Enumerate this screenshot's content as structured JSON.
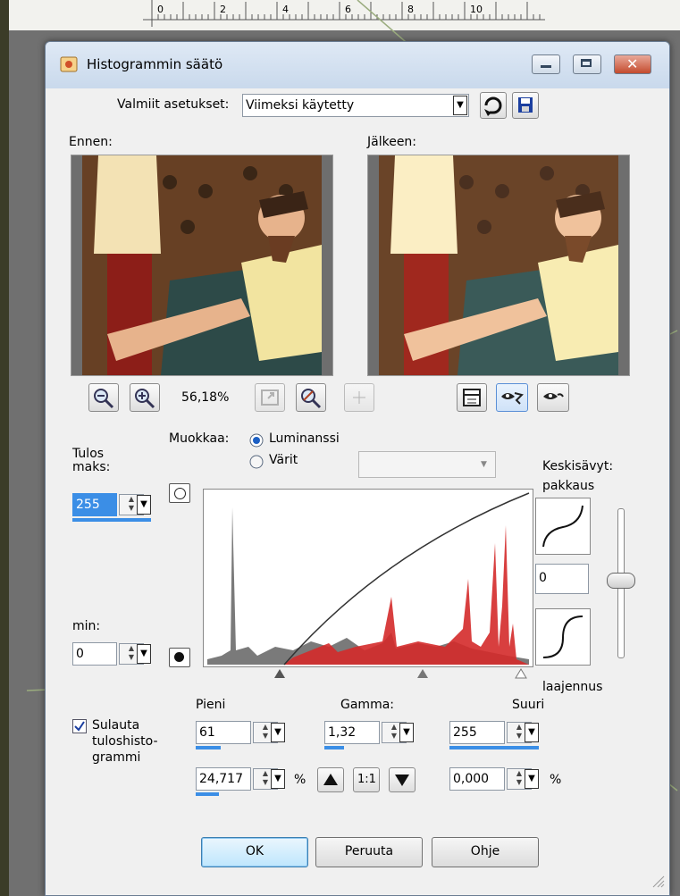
{
  "ruler": {
    "marks": [
      "0",
      "2",
      "4",
      "6",
      "8",
      "10"
    ]
  },
  "dialog": {
    "title": "Histogrammin säätö",
    "presets_label": "Valmiit asetukset:",
    "presets_value": "Viimeksi käytetty",
    "before_label": "Ennen:",
    "after_label": "Jälkeen:",
    "zoom_value": "56,18%",
    "output_max_label": "Tulos\nmaks:",
    "output_max_value": "255",
    "output_min_label": "min:",
    "output_min_value": "0",
    "edit_label": "Muokkaa:",
    "luminance_label": "Luminanssi",
    "colors_label": "Värit",
    "midtones_label": "Keskisävyt:\npakkaus",
    "midtones_value": "0",
    "expand_label": "laajennus",
    "low_label": "Pieni",
    "gamma_label": "Gamma:",
    "high_label": "Suuri",
    "low_value": "61",
    "gamma_value": "1,32",
    "high_value": "255",
    "low_percent_value": "24,717",
    "high_percent_value": "0,000",
    "percent_symbol": "%",
    "ratio_label": "1:1",
    "blend_label": "Sulauta\ntuloshisto-\ngrammi",
    "blend_checked": true,
    "ok_label": "OK",
    "cancel_label": "Peruuta",
    "help_label": "Ohje"
  },
  "colors": {
    "accent": "#3b8ee6",
    "histogram_red": "#d42a2a",
    "histogram_gray": "#7a7a7a"
  }
}
